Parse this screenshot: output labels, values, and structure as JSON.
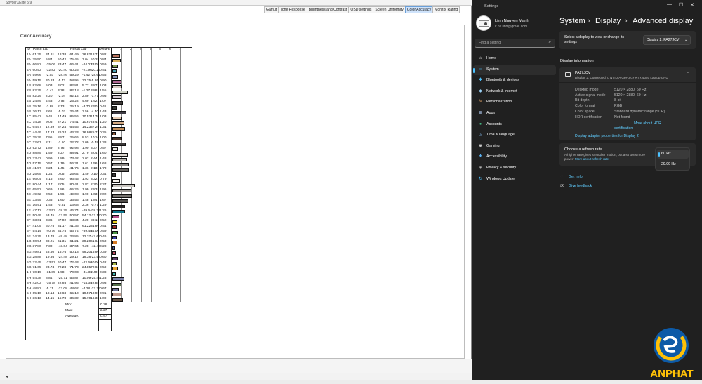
{
  "spyder": {
    "window_title": "SpyderXElite 5.9",
    "tabs": [
      "Gamut",
      "Tone Response",
      "Brightness and Contrast",
      "OSD settings",
      "Screen Uniformity",
      "Color Accuracy",
      "Monitor Rating"
    ],
    "active_tab": "Color Accuracy",
    "report_title": "Color Accuracy",
    "table": {
      "headers": {
        "id": "ID",
        "patch": "Patch Lab",
        "result": "Result Lab",
        "delta": "Delta-E"
      },
      "scale_ticks": [
        "1",
        "2",
        "3",
        "4",
        "5",
        "6",
        "7"
      ],
      "rows": [
        [
          "1A",
          "61.35",
          "34.81",
          "18.38",
          "61.49",
          "36.82",
          "18.71",
          "0.82"
        ],
        [
          "2A",
          "75.50",
          "5.84",
          "50.42",
          "75.45",
          "7.04",
          "50.25",
          "0.84"
        ],
        [
          "3A",
          "66.82",
          "-25.06",
          "23.47",
          "66.41",
          "-24.03",
          "23.08",
          "0.59"
        ],
        [
          "4A",
          "60.53",
          "-32.82",
          "-20.40",
          "60.25",
          "-21.96",
          "-20.25",
          "0.41"
        ],
        [
          "5A",
          "59.66",
          "-2.03",
          "-28.46",
          "59.29",
          "-1.42",
          "-28.61",
          "0.56"
        ],
        [
          "6A",
          "59.15",
          "30.83",
          "-5.72",
          "58.95",
          "32.75",
          "-5.26",
          "0.90"
        ],
        [
          "1B",
          "82.68",
          "5.03",
          "3.02",
          "82.81",
          "5.77",
          "3.87",
          "1.03"
        ],
        [
          "2B",
          "82.25",
          "-2.42",
          "3.78",
          "82.18",
          "-1.27",
          "3.88",
          "1.55"
        ],
        [
          "3B",
          "82.29",
          "2.20",
          "-2.04",
          "82.14",
          "2.89",
          "-1.77",
          "0.95"
        ],
        [
          "4B",
          "24.89",
          "4.43",
          "0.78",
          "25.22",
          "4.69",
          "1.92",
          "1.07"
        ],
        [
          "5B",
          "25.16",
          "-3.88",
          "2.13",
          "25.19",
          "-3.70",
          "2.50",
          "0.41"
        ],
        [
          "6B",
          "26.13",
          "2.61",
          "-5.03",
          "26.44",
          "3.56",
          "-4.40",
          "1.43"
        ],
        [
          "1C",
          "85.42",
          "9.41",
          "14.49",
          "85.56",
          "10.53",
          "14.70",
          "1.03"
        ],
        [
          "2C",
          "74.28",
          "9.05",
          "27.21",
          "74.41",
          "10.67",
          "28.41",
          "1.20"
        ],
        [
          "3C",
          "64.57",
          "12.39",
          "37.24",
          "64.56",
          "14.23",
          "37.26",
          "1.31"
        ],
        [
          "4C",
          "44.49",
          "17.23",
          "26.24",
          "44.23",
          "16.98",
          "25.72",
          "0.35"
        ],
        [
          "5C",
          "25.29",
          "7.95",
          "8.87",
          "25.66",
          "8.53",
          "10.16",
          "1.00"
        ],
        [
          "6C",
          "22.67",
          "2.11",
          "-1.10",
          "22.72",
          "3.09",
          "-0.49",
          "1.38"
        ],
        [
          "1D",
          "92.72",
          "1.89",
          "2.76",
          "92.98",
          "1.90",
          "3.37",
          "0.57"
        ],
        [
          "2D",
          "88.85",
          "1.59",
          "2.27",
          "88.91",
          "2.79",
          "3.04",
          "1.60"
        ],
        [
          "3D",
          "73.42",
          "0.99",
          "1.89",
          "73.42",
          "2.02",
          "2.44",
          "1.48"
        ],
        [
          "4D",
          "57.15",
          "0.57",
          "1.19",
          "56.31",
          "1.61",
          "1.56",
          "1.68"
        ],
        [
          "5D",
          "41.57",
          "0.24",
          "1.45",
          "41.76",
          "1.36",
          "2.13",
          "1.70"
        ],
        [
          "6D",
          "25.65",
          "1.24",
          "0.05",
          "25.64",
          "1.49",
          "0.10",
          "0.34"
        ],
        [
          "1E",
          "96.04",
          "2.16",
          "2.60",
          "96.45",
          "1.93",
          "3.32",
          "0.79"
        ],
        [
          "2E",
          "80.44",
          "1.17",
          "2.05",
          "80.41",
          "2.87",
          "2.20",
          "2.27"
        ],
        [
          "3E",
          "65.52",
          "0.69",
          "1.86",
          "65.26",
          "1.99",
          "2.83",
          "1.96"
        ],
        [
          "4E",
          "49.62",
          "0.58",
          "1.56",
          "49.08",
          "1.90",
          "1.03",
          "2.02"
        ],
        [
          "5E",
          "33.55",
          "0.35",
          "1.60",
          "33.56",
          "1.48",
          "1.84",
          "1.67"
        ],
        [
          "6E",
          "16.91",
          "1.43",
          "-0.81",
          "16.68",
          "2.36",
          "-0.77",
          "1.29"
        ],
        [
          "1F",
          "47.12",
          "-32.52",
          "-28.75",
          "46.74",
          "-29.64",
          "-28.36",
          "1.26"
        ],
        [
          "2F",
          "50.49",
          "53.45",
          "-13.55",
          "50.57",
          "54.12",
          "-12.15",
          "0.70"
        ],
        [
          "3F",
          "83.61",
          "3.36",
          "87.02",
          "83.84",
          "4.20",
          "88.10",
          "0.52"
        ],
        [
          "4F",
          "41.05",
          "60.75",
          "31.17",
          "41.36",
          "61.22",
          "31.99",
          "0.44"
        ],
        [
          "5F",
          "54.14",
          "-40.76",
          "34.75",
          "53.74",
          "-39.48",
          "34.00",
          "0.59"
        ],
        [
          "6F",
          "24.75",
          "13.78",
          "-49.48",
          "24.85",
          "12.37",
          "-47.62",
          "0.46"
        ],
        [
          "1G",
          "60.94",
          "38.21",
          "61.31",
          "61.21",
          "39.20",
          "61.64",
          "0.50"
        ],
        [
          "2G",
          "37.80",
          "7.30",
          "-43.04",
          "37.64",
          "7.28",
          "-42.46",
          "0.28"
        ],
        [
          "3G",
          "49.81",
          "48.50",
          "15.76",
          "50.13",
          "49.20",
          "15.96",
          "0.39"
        ],
        [
          "4G",
          "28.88",
          "19.36",
          "-24.48",
          "29.17",
          "19.38",
          "-23.58",
          "0.60"
        ],
        [
          "5G",
          "72.45",
          "-23.57",
          "60.47",
          "72.43",
          "-22.66",
          "60.06",
          "0.42"
        ],
        [
          "6G",
          "71.65",
          "23.74",
          "72.28",
          "71.73",
          "24.85",
          "72.63",
          "0.59"
        ],
        [
          "1H",
          "70.19",
          "-31.85",
          "1.98",
          "70.03",
          "-31.36",
          "2.40",
          "0.38"
        ],
        [
          "2H",
          "54.38",
          "8.84",
          "-25.71",
          "53.87",
          "10.09",
          "-25.46",
          "1.23"
        ],
        [
          "3H",
          "42.03",
          "-15.78",
          "22.93",
          "41.96",
          "-14.35",
          "22.88",
          "0.93"
        ],
        [
          "4H",
          "48.82",
          "-5.11",
          "-23.08",
          "48.62",
          "-4.28",
          "-22.29",
          "0.67"
        ],
        [
          "5H",
          "65.10",
          "18.14",
          "18.68",
          "65.10",
          "19.57",
          "18.90",
          "0.91"
        ],
        [
          "6H",
          "36.13",
          "14.15",
          "15.78",
          "36.32",
          "15.70",
          "16.38",
          "1.09"
        ]
      ],
      "swatches": [
        "#b8735e",
        "#d7b15a",
        "#7c9a52",
        "#4aa1b1",
        "#8795bc",
        "#b26a96",
        "#d8ccc3",
        "#d0d3c6",
        "#d6ccd3",
        "#3f3a38",
        "#393c36",
        "#3d3a43",
        "#e9cdb6",
        "#d5aa83",
        "#c38d58",
        "#8c593b",
        "#4a3428",
        "#3b3737",
        "#ebe7e2",
        "#ddd8d2",
        "#b5b1ac",
        "#8b8885",
        "#625f5b",
        "#3e3c3b",
        "#f5f1ed",
        "#c9c6c1",
        "#a09c98",
        "#76736f",
        "#4f4d4a",
        "#232122",
        "#10788e",
        "#b44d8a",
        "#e3cc1b",
        "#a32b28",
        "#4c9644",
        "#3b3ea8",
        "#d57b26",
        "#4c59a6",
        "#be4d63",
        "#5d3d6a",
        "#a6ba47",
        "#e6a232",
        "#3fb3a9",
        "#7a81aa",
        "#55704b",
        "#6a7199",
        "#c09b8e",
        "#695647"
      ],
      "summary": {
        "min_label": "Min:",
        "min": "0.28",
        "max_label": "Max:",
        "max": "2.27",
        "avg_label": "Average:",
        "avg": "0.97"
      }
    }
  },
  "settings": {
    "window_title": "Settings",
    "user": {
      "name": "Linh Nguyen Manh",
      "email": "lt.nlt.linh@gmail.com"
    },
    "search_placeholder": "Find a setting",
    "nav": [
      {
        "icon": "home-icon",
        "label": "Home",
        "glyph": "⌂",
        "color": "#e0e0e0"
      },
      {
        "icon": "system-icon",
        "label": "System",
        "glyph": "▭",
        "color": "#4cc2ff"
      },
      {
        "icon": "bluetooth-icon",
        "label": "Bluetooth & devices",
        "glyph": "✱",
        "color": "#4cc2ff"
      },
      {
        "icon": "network-icon",
        "label": "Network & internet",
        "glyph": "◆",
        "color": "#9ad0f5"
      },
      {
        "icon": "personalization-icon",
        "label": "Personalization",
        "glyph": "✎",
        "color": "#e8a86a"
      },
      {
        "icon": "apps-icon",
        "label": "Apps",
        "glyph": "▦",
        "color": "#9fb6d8"
      },
      {
        "icon": "accounts-icon",
        "label": "Accounts",
        "glyph": "●",
        "color": "#49c08a"
      },
      {
        "icon": "time-language-icon",
        "label": "Time & language",
        "glyph": "◷",
        "color": "#7fb7e8"
      },
      {
        "icon": "gaming-icon",
        "label": "Gaming",
        "glyph": "◉",
        "color": "#c8c8c8"
      },
      {
        "icon": "accessibility-icon",
        "label": "Accessibility",
        "glyph": "✚",
        "color": "#5ab0f0"
      },
      {
        "icon": "privacy-icon",
        "label": "Privacy & security",
        "glyph": "◈",
        "color": "#b0b0b0"
      },
      {
        "icon": "windows-update-icon",
        "label": "Windows Update",
        "glyph": "↻",
        "color": "#4cc2ff"
      }
    ],
    "breadcrumb": [
      "System",
      "Display",
      "Advanced display"
    ],
    "select_display_label_1": "Select a display to view or change its",
    "select_display_label_2": "settings",
    "display_select_value": "Display 2: PA27JCV",
    "display_info_heading": "Display information",
    "monitor_name": "PA27JCV",
    "monitor_sub": "Display 2: Connected to NVIDIA GeForce RTX 4050 Laptop GPU",
    "info_rows": [
      {
        "label": "Desktop mode",
        "value": "5120 × 2880, 60 Hz"
      },
      {
        "label": "Active signal mode",
        "value": "5120 × 2880, 60 Hz"
      },
      {
        "label": "Bit depth",
        "value": "8-bit"
      },
      {
        "label": "Color format",
        "value": "RGB"
      },
      {
        "label": "Color space",
        "value": "Standard dynamic range (SDR)"
      },
      {
        "label": "HDR certification",
        "value": "Not found"
      }
    ],
    "hdr_link_1": "More about HDR",
    "hdr_link_2": "certification",
    "adapter_link": "Display adapter properties for Display 2",
    "refresh_title": "Choose a refresh rate",
    "refresh_desc_1": "A higher rate gives smoother motion, but also uses more",
    "refresh_desc_2": "power",
    "refresh_more": "More about refresh rate",
    "refresh_options": [
      "60 Hz",
      "29.99 Hz"
    ],
    "refresh_selected": "60 Hz",
    "help": "Get help",
    "feedback": "Give feedback"
  },
  "watermark": {
    "text": "ANPHAT",
    "colors": {
      "yellow": "#ffc107",
      "blue": "#0d5aa7"
    }
  }
}
